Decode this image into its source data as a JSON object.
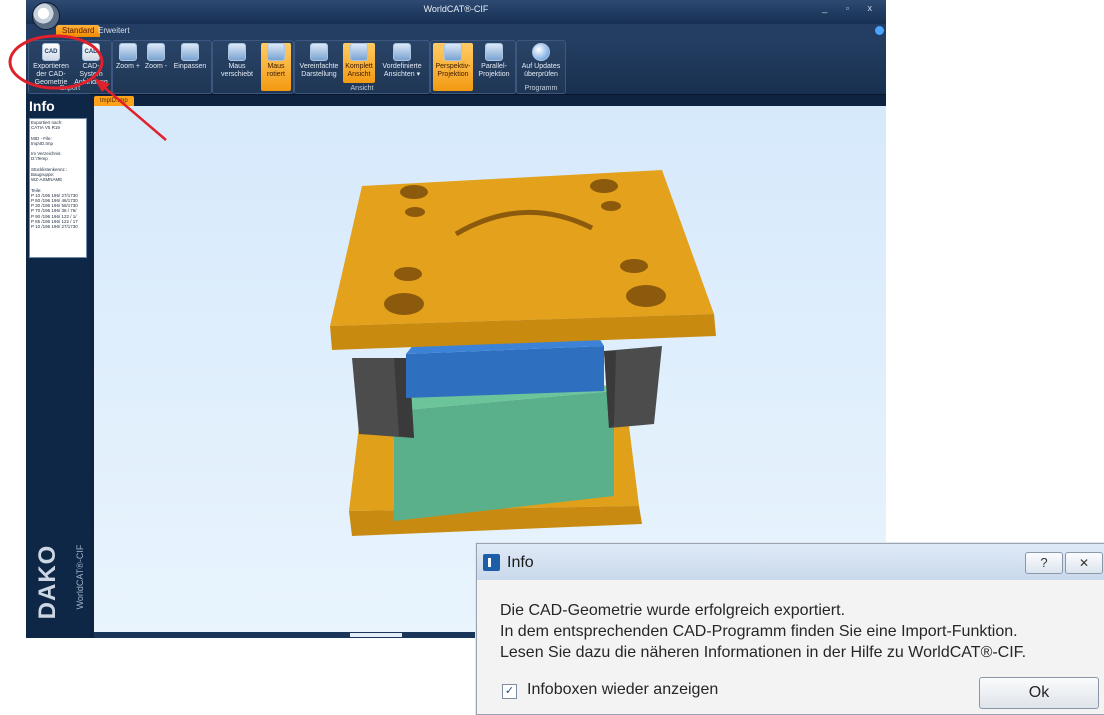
{
  "app": {
    "title": "WorldCAT®-CIF",
    "window_buttons": "_ ▫ x"
  },
  "tabs": [
    {
      "label": "Standard"
    },
    {
      "label": "Erweitert"
    }
  ],
  "ribbon": {
    "groups": [
      {
        "label": "Export",
        "buttons": [
          {
            "label": "Exportieren der CAD-Geometrie",
            "icon": "cad-export-icon",
            "active": false
          },
          {
            "label": "CAD-System Anbindung",
            "icon": "cad-link-icon",
            "active": false
          }
        ]
      },
      {
        "label": "",
        "buttons": [
          {
            "label": "Zoom +",
            "icon": "zoom-in-icon",
            "active": false
          },
          {
            "label": "Zoom -",
            "icon": "zoom-out-icon",
            "active": false
          },
          {
            "label": "Einpassen",
            "icon": "fit-icon",
            "active": false
          }
        ]
      },
      {
        "label": "",
        "buttons": [
          {
            "label": "Maus verschiebt",
            "icon": "pan-icon",
            "active": false
          },
          {
            "label": "Maus rotiert",
            "icon": "rotate-icon",
            "active": true
          }
        ]
      },
      {
        "label": "Ansicht",
        "buttons": [
          {
            "label": "Vereinfachte Darstellung",
            "icon": "simplified-view-icon",
            "active": false
          },
          {
            "label": "Komplett Ansicht",
            "icon": "full-view-icon",
            "active": true
          },
          {
            "label": "Vordefinierte Ansichten ▾",
            "icon": "predefined-views-icon",
            "active": false
          }
        ]
      },
      {
        "label": "",
        "buttons": [
          {
            "label": "Perspektiv-Projektion",
            "icon": "perspective-icon",
            "active": true
          },
          {
            "label": "Parallel-Projektion",
            "icon": "parallel-icon",
            "active": false
          }
        ]
      },
      {
        "label": "Programm",
        "buttons": [
          {
            "label": "Auf Updates überprüfen",
            "icon": "update-globe-icon",
            "active": false
          }
        ]
      }
    ]
  },
  "info_panel": {
    "title": "Info",
    "lines": [
      "Exportiert nach:",
      "CATIA V5 R19",
      "",
      "MID - File:",
      "tmp\\ID.tmp",
      "",
      "Im Verzeichnis:",
      "D:\\Temp",
      "",
      "Stücklistenkennz.:",
      "Baugruppe:",
      "WZ-ASMNAME",
      "",
      "Teile:",
      "P 10 /196 196/ 27/1730",
      "P 50 /196 196/ 46/1730",
      "P 30 /196 196/ 56/1730",
      "P 70 /196 196/ 38 / 76/",
      "P 90 /196 196/ 122 / 1/",
      "P 85 /196 196/ 122 / 17",
      "P 10 /196 196/ 27/1730"
    ],
    "brand": "DAKO",
    "product": "WorldCAT®-CIF"
  },
  "document_tab": {
    "label": "tmpID.tmp"
  },
  "model": {
    "colors": {
      "plate_top": "#e4a11b",
      "plate_side": "#c98a10",
      "pillar": "#4a4a4a",
      "blue_block": "#2f6fc0",
      "green_block": "#5ab08a"
    }
  },
  "dialog": {
    "title": "Info",
    "help_label": "?",
    "close_label": "✕",
    "messages": [
      "Die CAD-Geometrie wurde erfolgreich exportiert.",
      "In dem entsprechenden CAD-Programm finden Sie eine Import-Funktion.",
      "Lesen Sie dazu die näheren Informationen in der Hilfe zu WorldCAT®-CIF."
    ],
    "checkbox_label": "Infoboxen wieder anzeigen",
    "checkbox_checked": true,
    "ok_label": "Ok"
  }
}
